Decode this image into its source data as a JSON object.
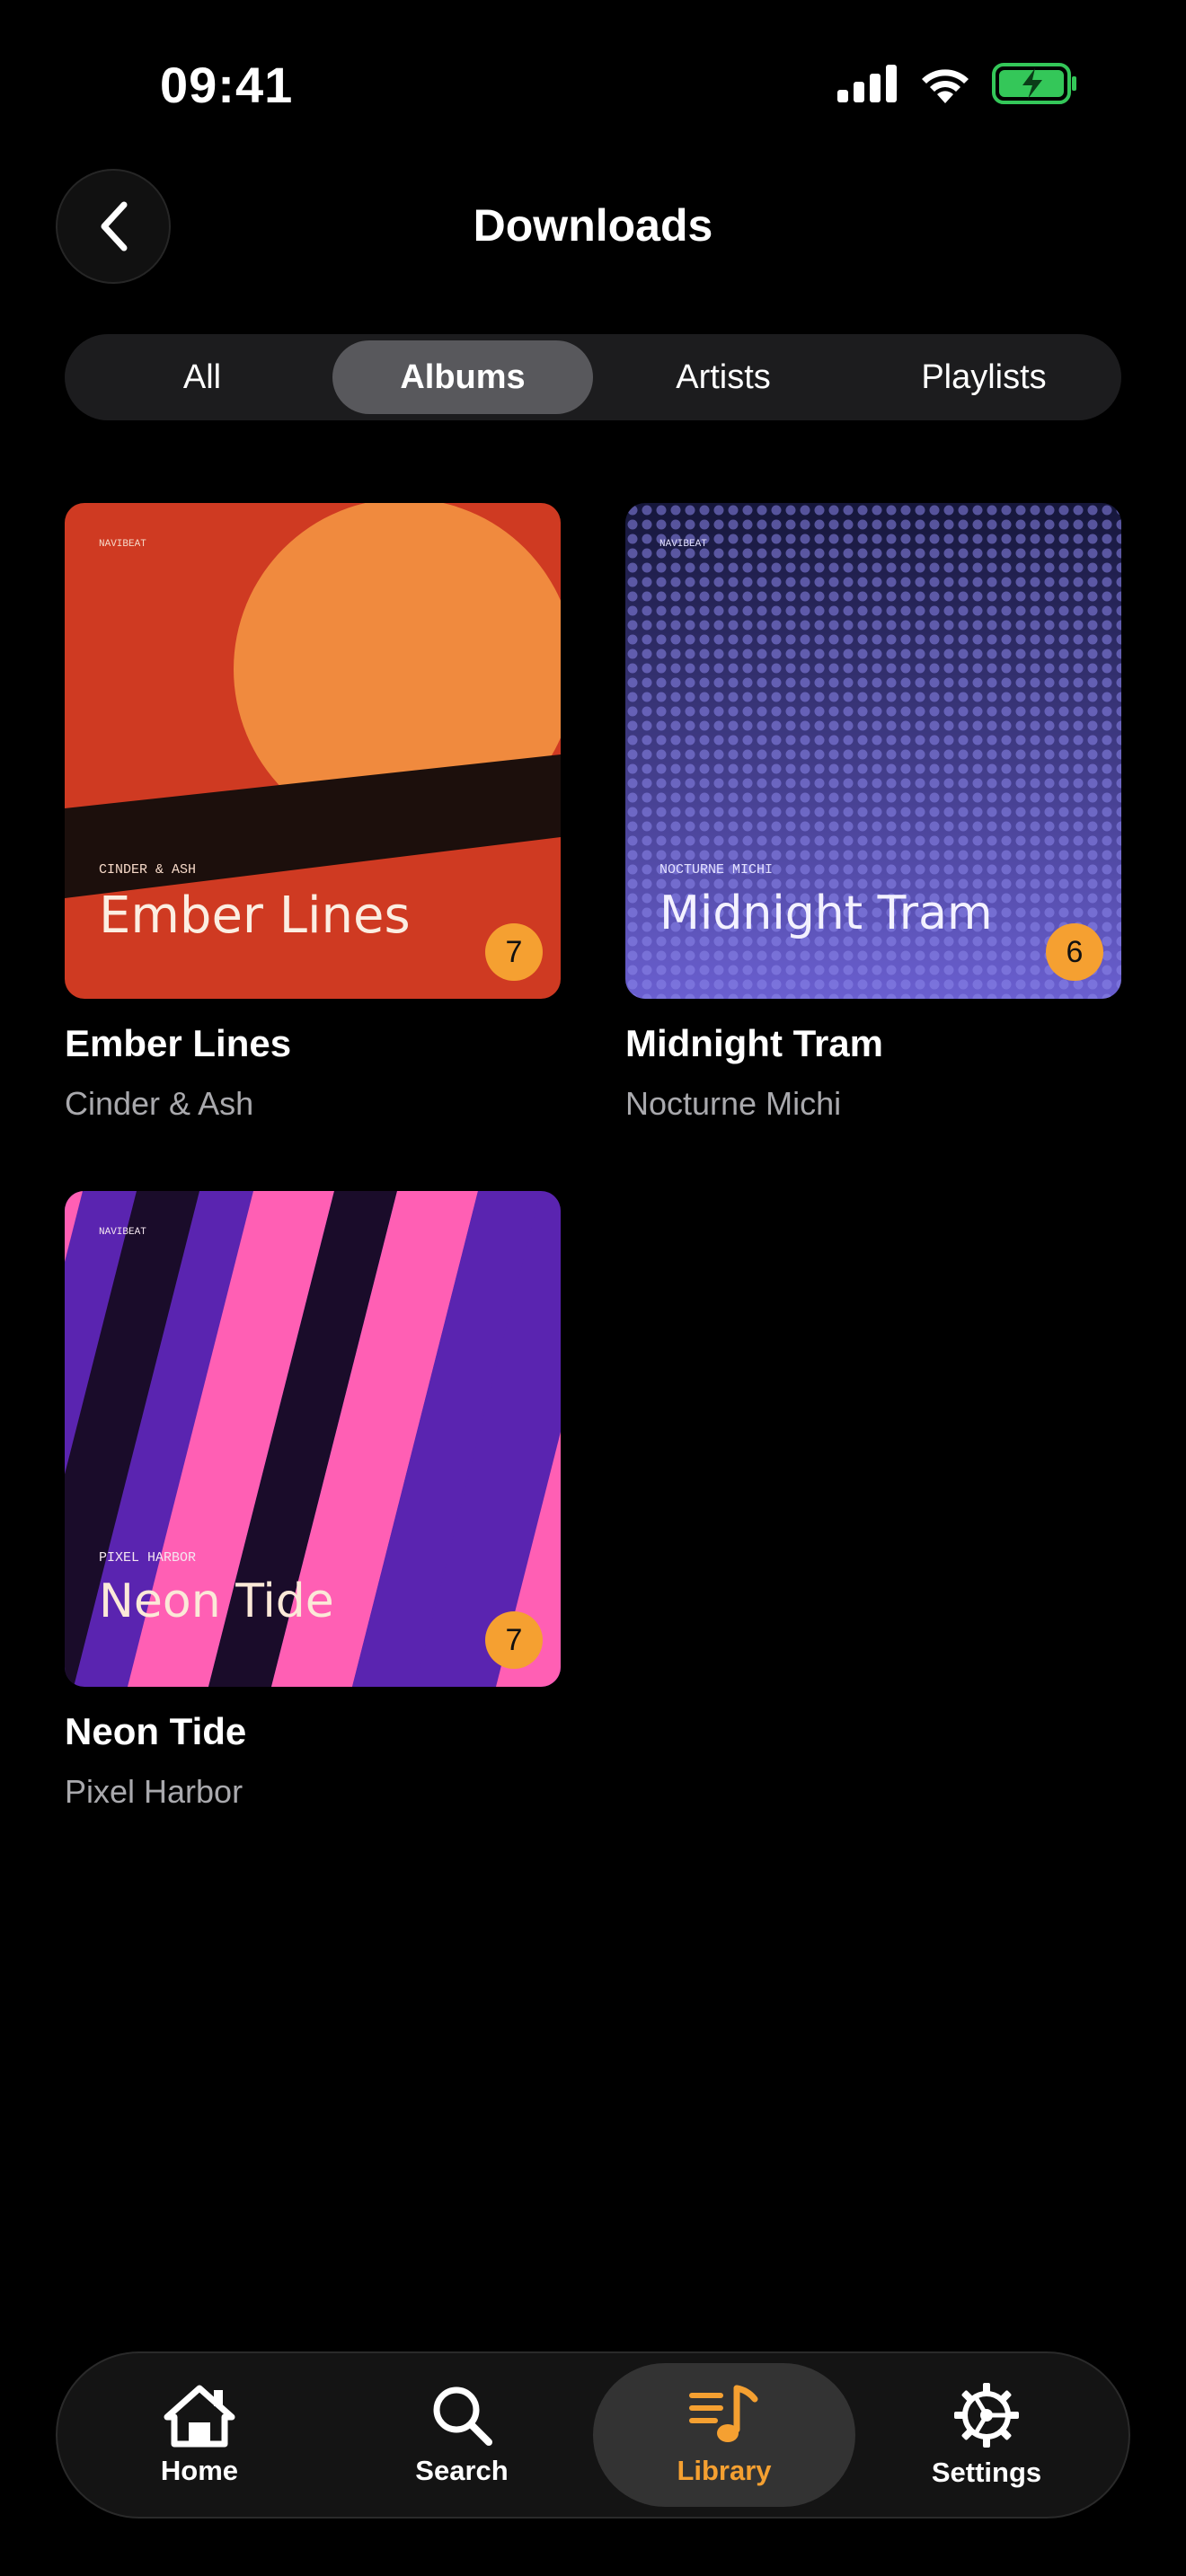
{
  "status": {
    "time": "09:41"
  },
  "header": {
    "title": "Downloads"
  },
  "filters": [
    {
      "label": "All",
      "active": false
    },
    {
      "label": "Albums",
      "active": true
    },
    {
      "label": "Artists",
      "active": false
    },
    {
      "label": "Playlists",
      "active": false
    }
  ],
  "albums": [
    {
      "title": "Ember Lines",
      "artist": "Cinder & Ash",
      "count": "7",
      "cover_brand": "NAVIBEAT",
      "cover_artist": "CINDER & ASH",
      "cover_title": "Ember Lines"
    },
    {
      "title": "Midnight Tram",
      "artist": "Nocturne Michi",
      "count": "6",
      "cover_brand": "NAVIBEAT",
      "cover_artist": "NOCTURNE MICHI",
      "cover_title": "Midnight Tram"
    },
    {
      "title": "Neon Tide",
      "artist": "Pixel Harbor",
      "count": "7",
      "cover_brand": "NAVIBEAT",
      "cover_artist": "PIXEL HARBOR",
      "cover_title": "Neon Tide"
    }
  ],
  "tabbar": [
    {
      "label": "Home",
      "icon": "home-icon",
      "active": false
    },
    {
      "label": "Search",
      "icon": "search-icon",
      "active": false
    },
    {
      "label": "Library",
      "icon": "library-icon",
      "active": true
    },
    {
      "label": "Settings",
      "icon": "settings-icon",
      "active": false
    }
  ],
  "colors": {
    "accent": "#f5a031",
    "background": "#000000",
    "battery": "#34c759"
  }
}
